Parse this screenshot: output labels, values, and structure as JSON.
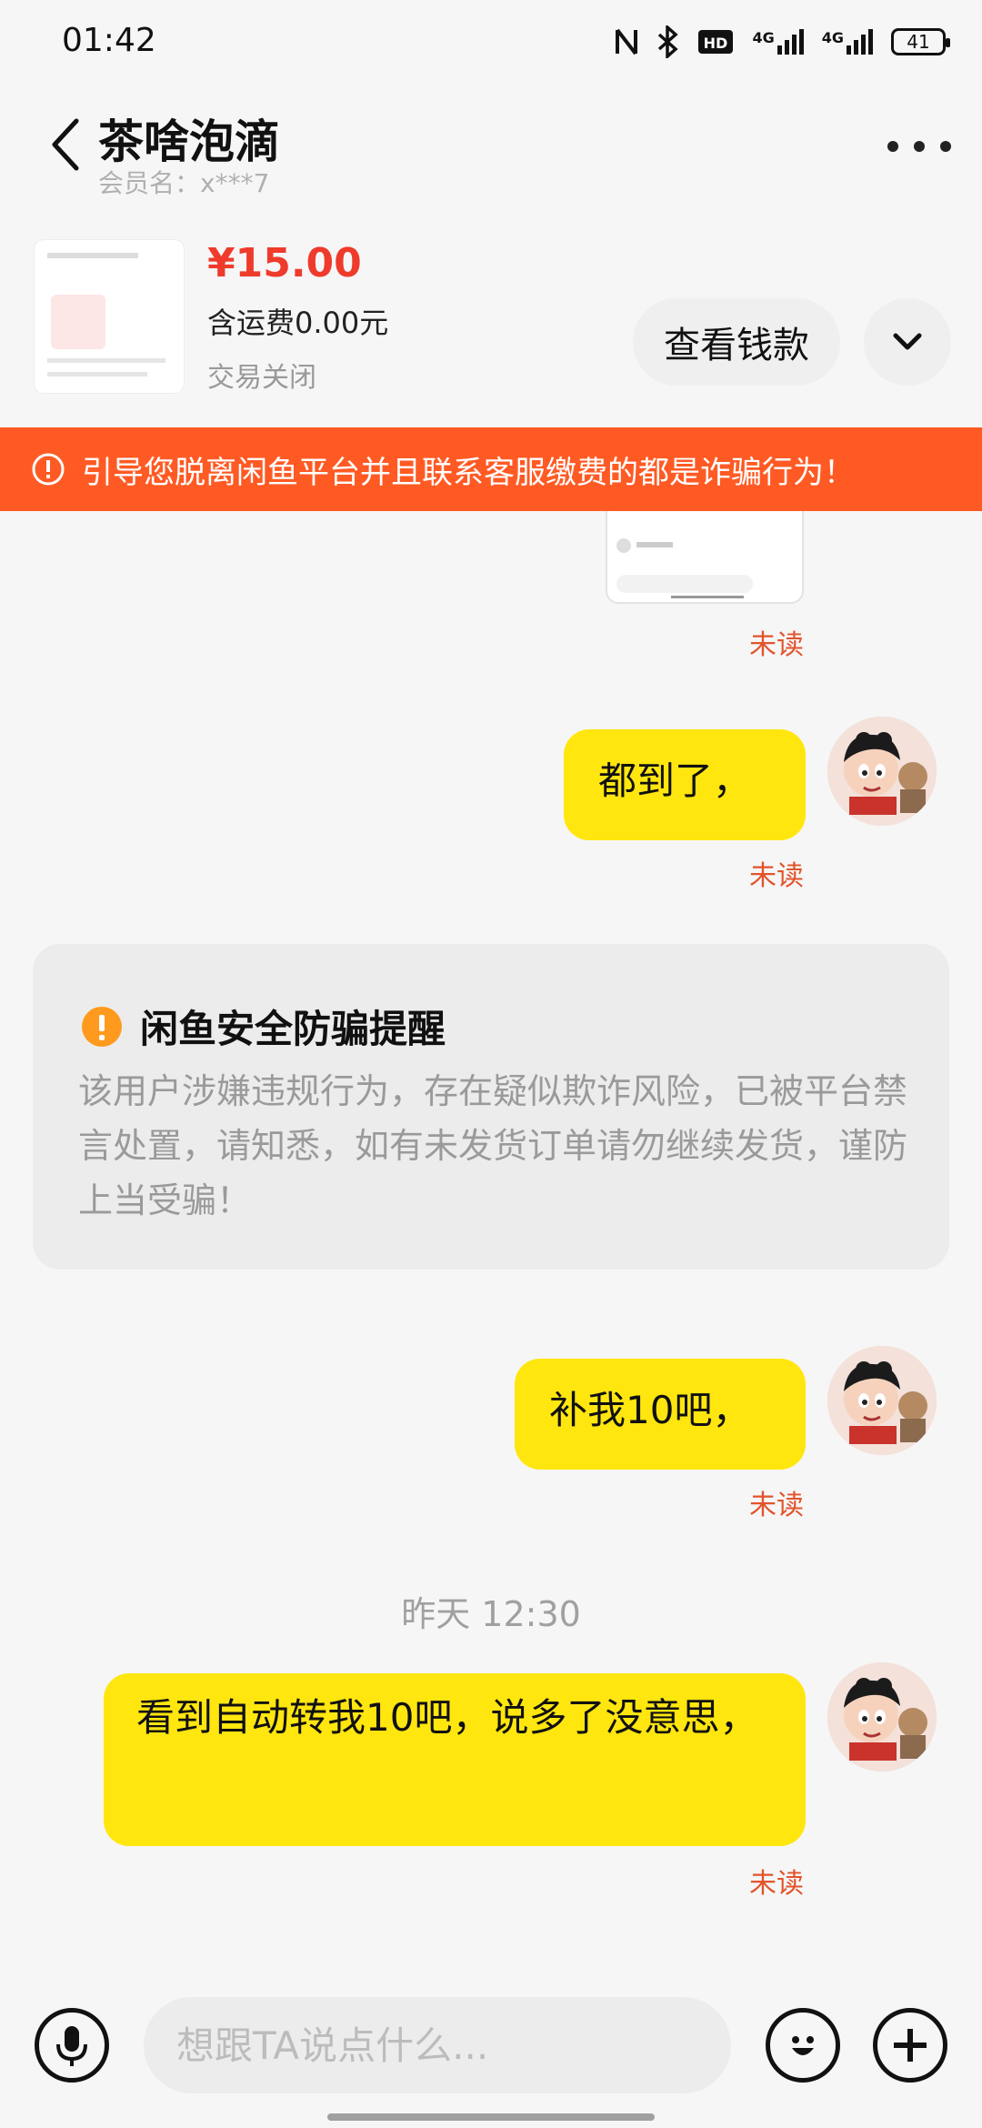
{
  "status_bar": {
    "time": "01:42",
    "battery": "41",
    "network_1": "4G",
    "network_2": "4G"
  },
  "header": {
    "title": "茶啥泡滴",
    "member_label": "会员名：",
    "member_name": "x***7"
  },
  "product": {
    "price": "¥15.00",
    "shipping": "含运费0.00元",
    "status": "交易关闭",
    "view_payment_label": "查看钱款"
  },
  "banner": {
    "text": "引导您脱离闲鱼平台并且联系客服缴费的都是诈骗行为！",
    "color": "#ff5a24"
  },
  "messages": [
    {
      "type": "image",
      "read_status": "未读"
    },
    {
      "type": "text",
      "text": "都到了，",
      "read_status": "未读"
    },
    {
      "type": "text",
      "text": "补我10吧，",
      "read_status": "未读"
    },
    {
      "type": "text",
      "text": "看到自动转我10吧，说多了没意思，",
      "read_status": "未读"
    }
  ],
  "safety_notice": {
    "title": "闲鱼安全防骗提醒",
    "body": "该用户涉嫌违规行为，存在疑似欺诈风险，已被平台禁言处置，请知悉，如有未发货订单请勿继续发货，谨防上当受骗！"
  },
  "timestamp": "昨天 12:30",
  "input_bar": {
    "placeholder": "想跟TA说点什么..."
  },
  "icons": [
    "back-icon",
    "more-icon",
    "chevron-down-icon",
    "warning-icon",
    "mic-icon",
    "emoji-icon",
    "plus-icon"
  ],
  "colors": {
    "bubble": "#ffe60f",
    "price": "#ee3b2b",
    "read_status": "#e2542c"
  }
}
